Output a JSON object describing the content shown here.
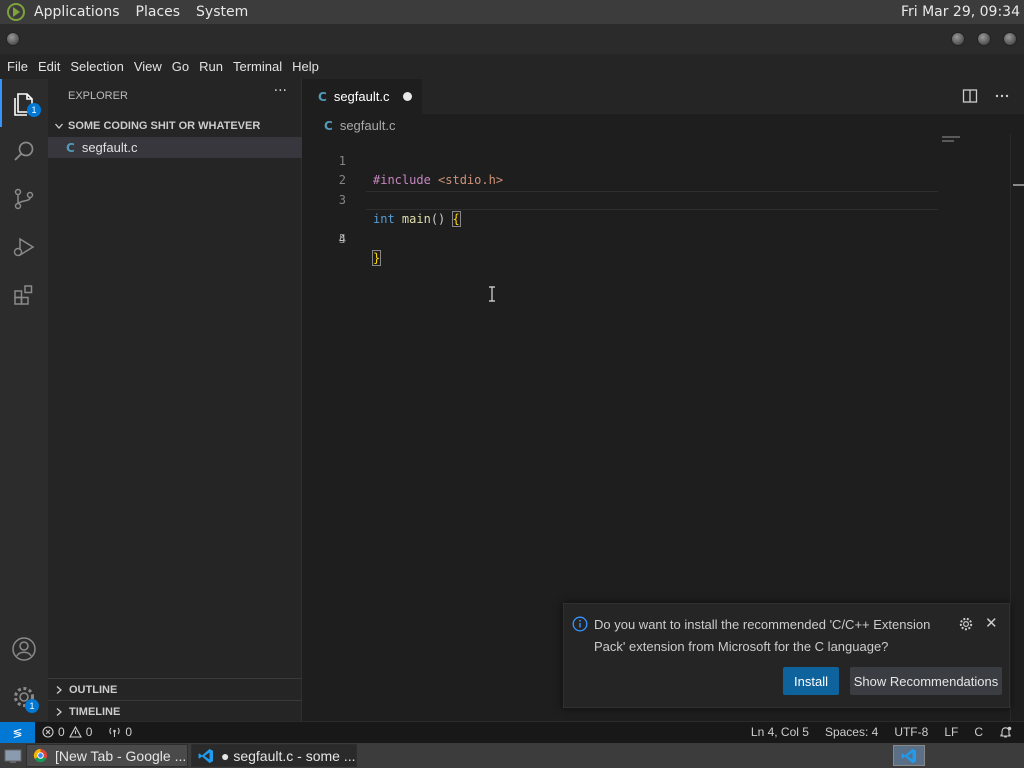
{
  "top_panel": {
    "menus": [
      "Applications",
      "Places",
      "System"
    ],
    "clock": "Fri Mar 29, 09:34"
  },
  "menubar": [
    "File",
    "Edit",
    "Selection",
    "View",
    "Go",
    "Run",
    "Terminal",
    "Help"
  ],
  "activity_bar": {
    "explorer_badge": "1",
    "settings_badge": "1",
    "items": [
      "files-icon",
      "search-icon",
      "source-control-icon",
      "run-debug-icon",
      "extensions-icon",
      "accounts-icon",
      "manage-gear-icon"
    ]
  },
  "sidebar": {
    "title": "EXPLORER",
    "more": "···",
    "folder": "SOME CODING SHIT OR WHATEVER",
    "file_icon": "C",
    "file": "segfault.c",
    "outline": "OUTLINE",
    "timeline": "TIMELINE"
  },
  "editor": {
    "tab_icon": "C",
    "tab_title": "segfault.c",
    "breadcrumb_icon": "C",
    "breadcrumb": "segfault.c",
    "line_numbers": [
      "1",
      "2",
      "3",
      "4",
      "5"
    ],
    "line1_directive": "#include",
    "line1_header": "<stdio.h>",
    "line3_type": "int",
    "line3_func": "main",
    "line3_parens": "()",
    "line3_brace": "{",
    "line5_brace": "}"
  },
  "notification": {
    "message": "Do you want to install the recommended 'C/C++ Extension Pack' extension from Microsoft for the C language?",
    "install": "Install",
    "show_recommendations": "Show Recommendations",
    "close": "✕"
  },
  "statusbar": {
    "remote": "≶",
    "errors": "0",
    "warnings": "0",
    "ports": "0",
    "position": "Ln 4, Col 5",
    "spaces": "Spaces: 4",
    "encoding": "UTF-8",
    "eol": "LF",
    "language": "C"
  },
  "taskbar": {
    "chrome": "[New Tab - Google ...",
    "vscode": "● segfault.c - some ..."
  },
  "colors": {
    "accent": "#0078d4",
    "install_button": "#0e639c",
    "background": "#1e1e1e"
  }
}
